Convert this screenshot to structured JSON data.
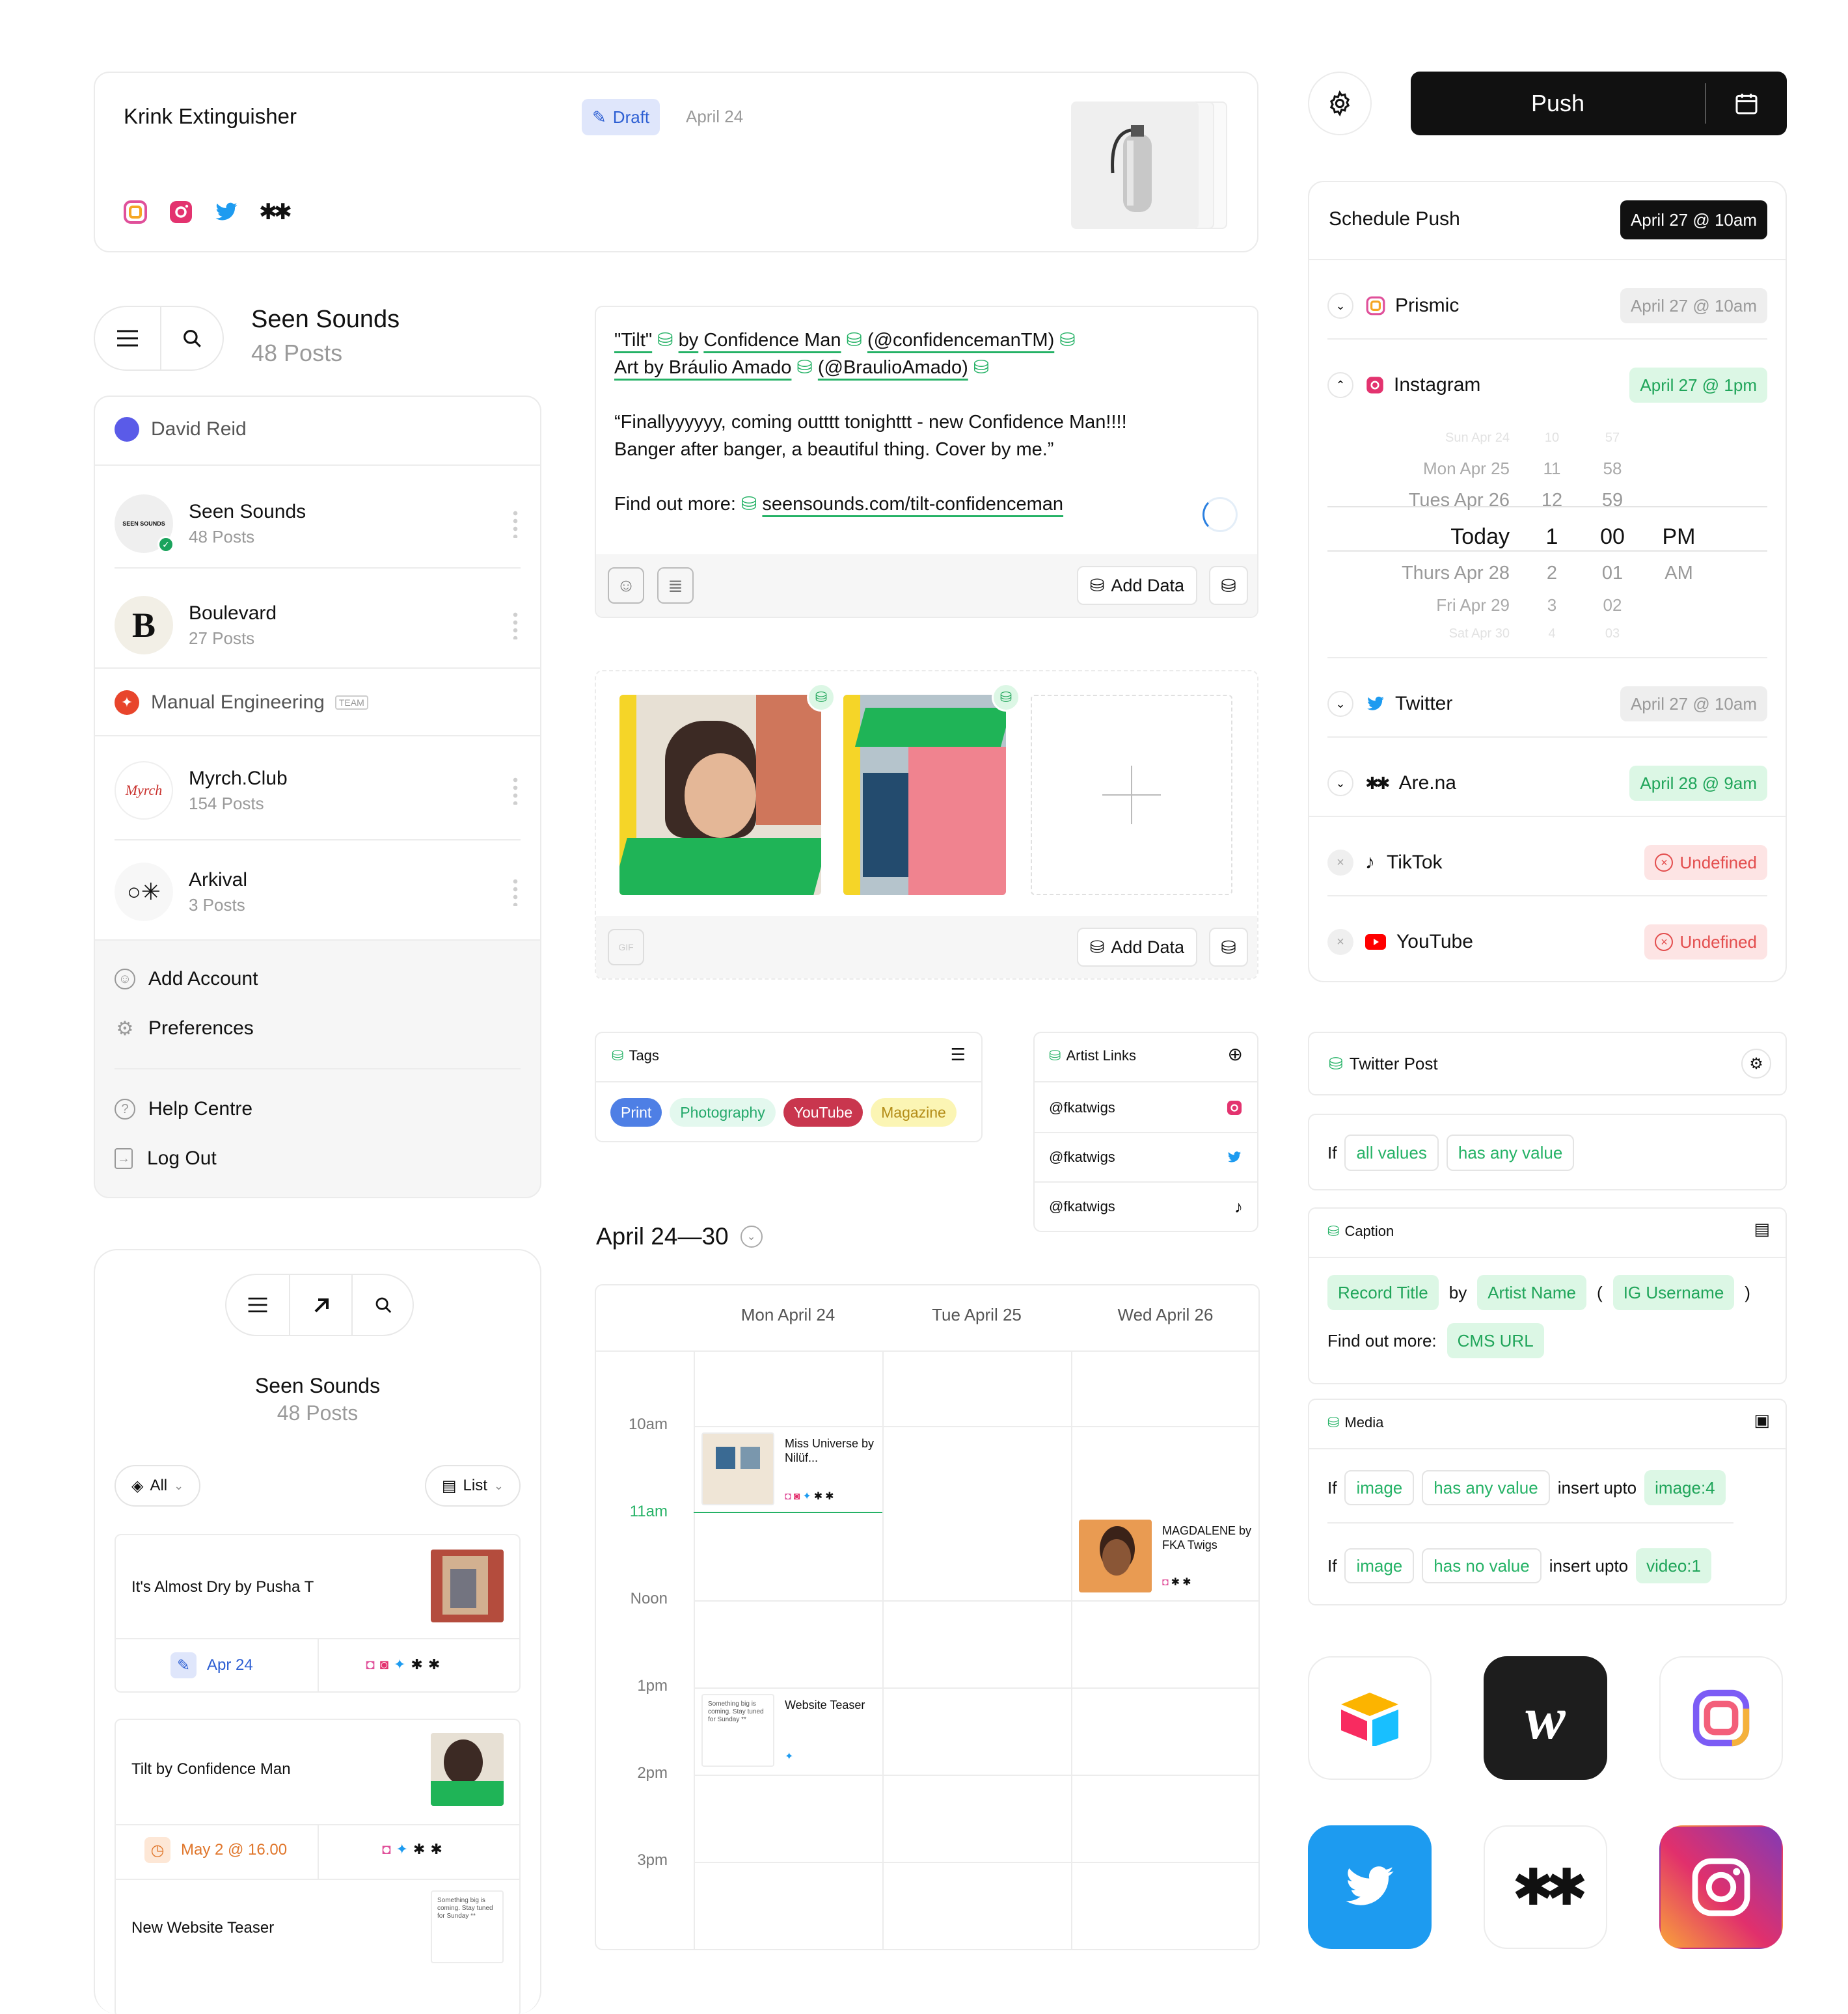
{
  "post_card": {
    "title": "Krink Extinguisher",
    "status": "Draft",
    "date": "April 24",
    "socials": [
      "prismic-icon",
      "instagram-icon",
      "twitter-icon",
      "arena-icon"
    ]
  },
  "push": {
    "label": "Push",
    "schedule_label": "Schedule Push",
    "schedule_date": "April 27 @ 10am",
    "channels": [
      {
        "name": "Prismic",
        "date": "April 27 @ 10am",
        "state": "gray"
      },
      {
        "name": "Instagram",
        "date": "April 27 @ 1pm",
        "state": "green"
      },
      {
        "name": "Twitter",
        "date": "April 27 @ 10am",
        "state": "gray"
      },
      {
        "name": "Are.na",
        "date": "April 28 @ 9am",
        "state": "green"
      },
      {
        "name": "TikTok",
        "date": "Undefined",
        "state": "red"
      },
      {
        "name": "YouTube",
        "date": "Undefined",
        "state": "red"
      }
    ],
    "picker": {
      "days": [
        "Sun Apr 24",
        "Mon Apr 25",
        "Tues Apr 26",
        "Today",
        "Thurs Apr 28",
        "Fri Apr 29",
        "Sat Apr 30"
      ],
      "hours": [
        "10",
        "11",
        "12",
        "1",
        "2",
        "3",
        "4"
      ],
      "minutes": [
        "57",
        "58",
        "59",
        "00",
        "01",
        "02",
        "03"
      ],
      "ampm": [
        "PM",
        "AM"
      ]
    }
  },
  "account_switcher": {
    "title": "Seen Sounds",
    "subtitle": "48 Posts",
    "groups": [
      {
        "name": "David Reid",
        "accounts": [
          {
            "name": "Seen Sounds",
            "posts": "48 Posts"
          },
          {
            "name": "Boulevard",
            "posts": "27 Posts"
          }
        ]
      },
      {
        "name": "Manual Engineering",
        "badge": "TEAM",
        "accounts": [
          {
            "name": "Myrch.Club",
            "posts": "154 Posts"
          },
          {
            "name": "Arkival",
            "posts": "3 Posts"
          }
        ]
      }
    ],
    "menu": [
      "Add Account",
      "Preferences",
      "Help Centre",
      "Log Out"
    ]
  },
  "caption_editor": {
    "line1_a": "\"Tilt\"",
    "line1_b": "by",
    "line1_c": "Confidence Man",
    "line1_d": "(@confidencemanTM)",
    "line2_a": "Art by Bráulio Amado",
    "line2_b": "(@BraulioAmado)",
    "quote1": "“Finallyyyyyy, coming outttt tonighttt - new Confidence Man!!!!",
    "quote2": "Banger after banger, a beautiful thing. Cover by me.”",
    "findout": "Find out more:",
    "link": "seensounds.com/tilt-confidenceman",
    "add_data": "Add Data"
  },
  "media_editor": {
    "add_data": "Add Data",
    "gif": "GIF"
  },
  "tags": {
    "title": "Tags",
    "items": [
      "Print",
      "Photography",
      "YouTube",
      "Magazine"
    ]
  },
  "artist_links": {
    "title": "Artist Links",
    "items": [
      "@fkatwigs",
      "@fkatwigs",
      "@fkatwigs"
    ]
  },
  "calendar": {
    "range": "April 24—30",
    "days": [
      "Mon April 24",
      "Tue April 25",
      "Wed April 26"
    ],
    "times": [
      "10am",
      "11am",
      "Noon",
      "1pm",
      "2pm",
      "3pm"
    ],
    "events": [
      {
        "title": "Miss Universe by Nilüf..."
      },
      {
        "title": "MAGDALENE by FKA Twigs"
      },
      {
        "title": "Website Teaser",
        "thumb": "Something big is coming. Stay tuned for Sunday **"
      }
    ]
  },
  "mobile_feed": {
    "title": "Seen Sounds",
    "subtitle": "48 Posts",
    "filter": "All",
    "view": "List",
    "posts": [
      {
        "title": "It's Almost Dry by Pusha T",
        "date": "Apr 24"
      },
      {
        "title": "Tilt by Confidence Man",
        "date": "May 2 @ 16.00"
      },
      {
        "title": "New Website Teaser",
        "thumb": "Something big is coming. Stay tuned for Sunday **"
      }
    ]
  },
  "rules": {
    "twitter_post": "Twitter Post",
    "if": "If",
    "all_values": "all values",
    "has_any_value": "has any value",
    "caption": "Caption",
    "record_title": "Record Title",
    "by": "by",
    "artist_name": "Artist Name",
    "open_paren": "(",
    "ig_username": "IG Username",
    "close_paren": ")",
    "find_out_more": "Find out more:",
    "cms_url": "CMS URL",
    "media": "Media",
    "image": "image",
    "has_no_value": "has no value",
    "insert_upto": "insert upto",
    "image4": "image:4",
    "video1": "video:1"
  },
  "colors": {
    "accent_green": "#25b266",
    "dark": "#111111",
    "draft_blue": "#2d5fd3"
  }
}
